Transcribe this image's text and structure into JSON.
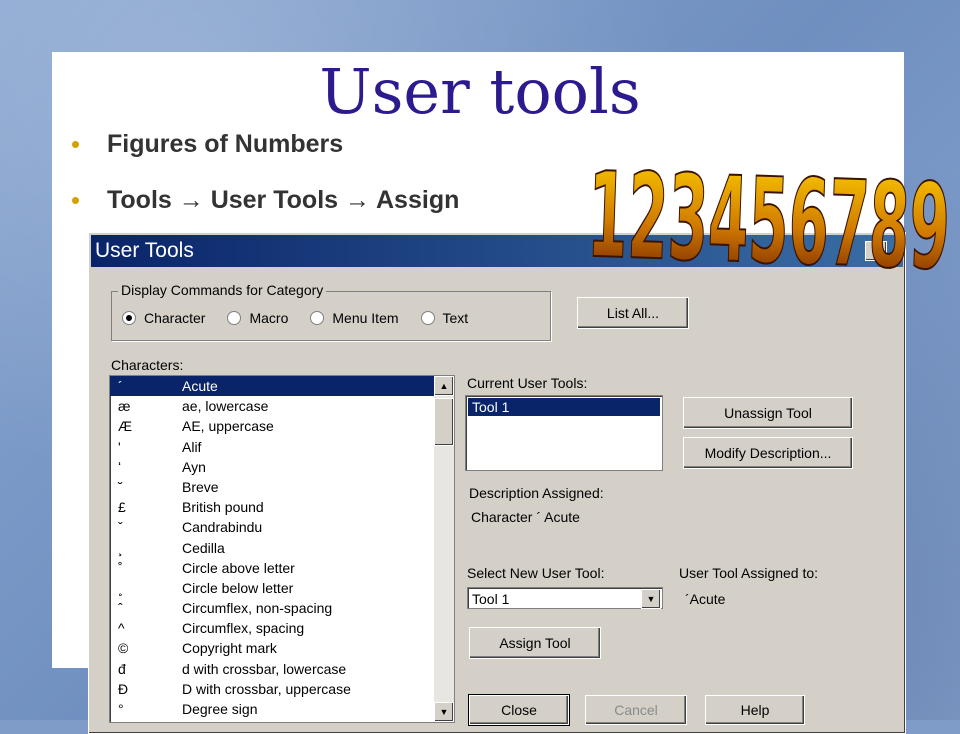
{
  "slide": {
    "title": "User tools",
    "bullets": [
      "Figures of Numbers",
      "Tools → User Tools → Assign"
    ],
    "wordart": "123456789"
  },
  "dialog": {
    "title": "User Tools",
    "close_glyph": "✕",
    "category_group": {
      "legend": "Display Commands for Category",
      "options": [
        {
          "label": "Character",
          "selected": true
        },
        {
          "label": "Macro",
          "selected": false
        },
        {
          "label": "Menu Item",
          "selected": false
        },
        {
          "label": "Text",
          "selected": false
        }
      ]
    },
    "list_all_label": "List All...",
    "characters_label": "Characters:",
    "characters": [
      {
        "symbol": "´",
        "name": "Acute",
        "selected": true
      },
      {
        "symbol": "æ",
        "name": "ae, lowercase"
      },
      {
        "symbol": "Æ",
        "name": "AE, uppercase"
      },
      {
        "symbol": "ʹ",
        "name": "Alif"
      },
      {
        "symbol": "ʻ",
        "name": "Ayn"
      },
      {
        "symbol": "˘",
        "name": "Breve"
      },
      {
        "symbol": "£",
        "name": "British pound"
      },
      {
        "symbol": "ˇ",
        "name": "Candrabindu"
      },
      {
        "symbol": "¸",
        "name": "Cedilla"
      },
      {
        "symbol": "˚",
        "name": "Circle above letter"
      },
      {
        "symbol": "˳",
        "name": "Circle below letter"
      },
      {
        "symbol": "ˆ",
        "name": "Circumflex, non-spacing"
      },
      {
        "symbol": "^",
        "name": "Circumflex, spacing"
      },
      {
        "symbol": "©",
        "name": "Copyright mark"
      },
      {
        "symbol": "đ",
        "name": "d with crossbar, lowercase"
      },
      {
        "symbol": "Đ",
        "name": "D with crossbar, uppercase"
      },
      {
        "symbol": "°",
        "name": "Degree sign"
      }
    ],
    "current_tools_label": "Current User Tools:",
    "current_tools": [
      "Tool 1"
    ],
    "unassign_label": "Unassign Tool",
    "modify_label": "Modify Description...",
    "description_assigned_label": "Description Assigned:",
    "description_value": "Character  ´ Acute",
    "select_new_label": "Select New User Tool:",
    "select_new_value": "Tool 1",
    "assigned_to_label": "User Tool Assigned to:",
    "assigned_to_value": "´Acute",
    "assign_label": "Assign Tool",
    "close_label": "Close",
    "cancel_label": "Cancel",
    "help_label": "Help",
    "colors": {
      "titlebar": "#0a246a",
      "dialog_bg": "#d4d0c8",
      "selection": "#0a246a",
      "slide_title": "#2b1b8f"
    }
  }
}
